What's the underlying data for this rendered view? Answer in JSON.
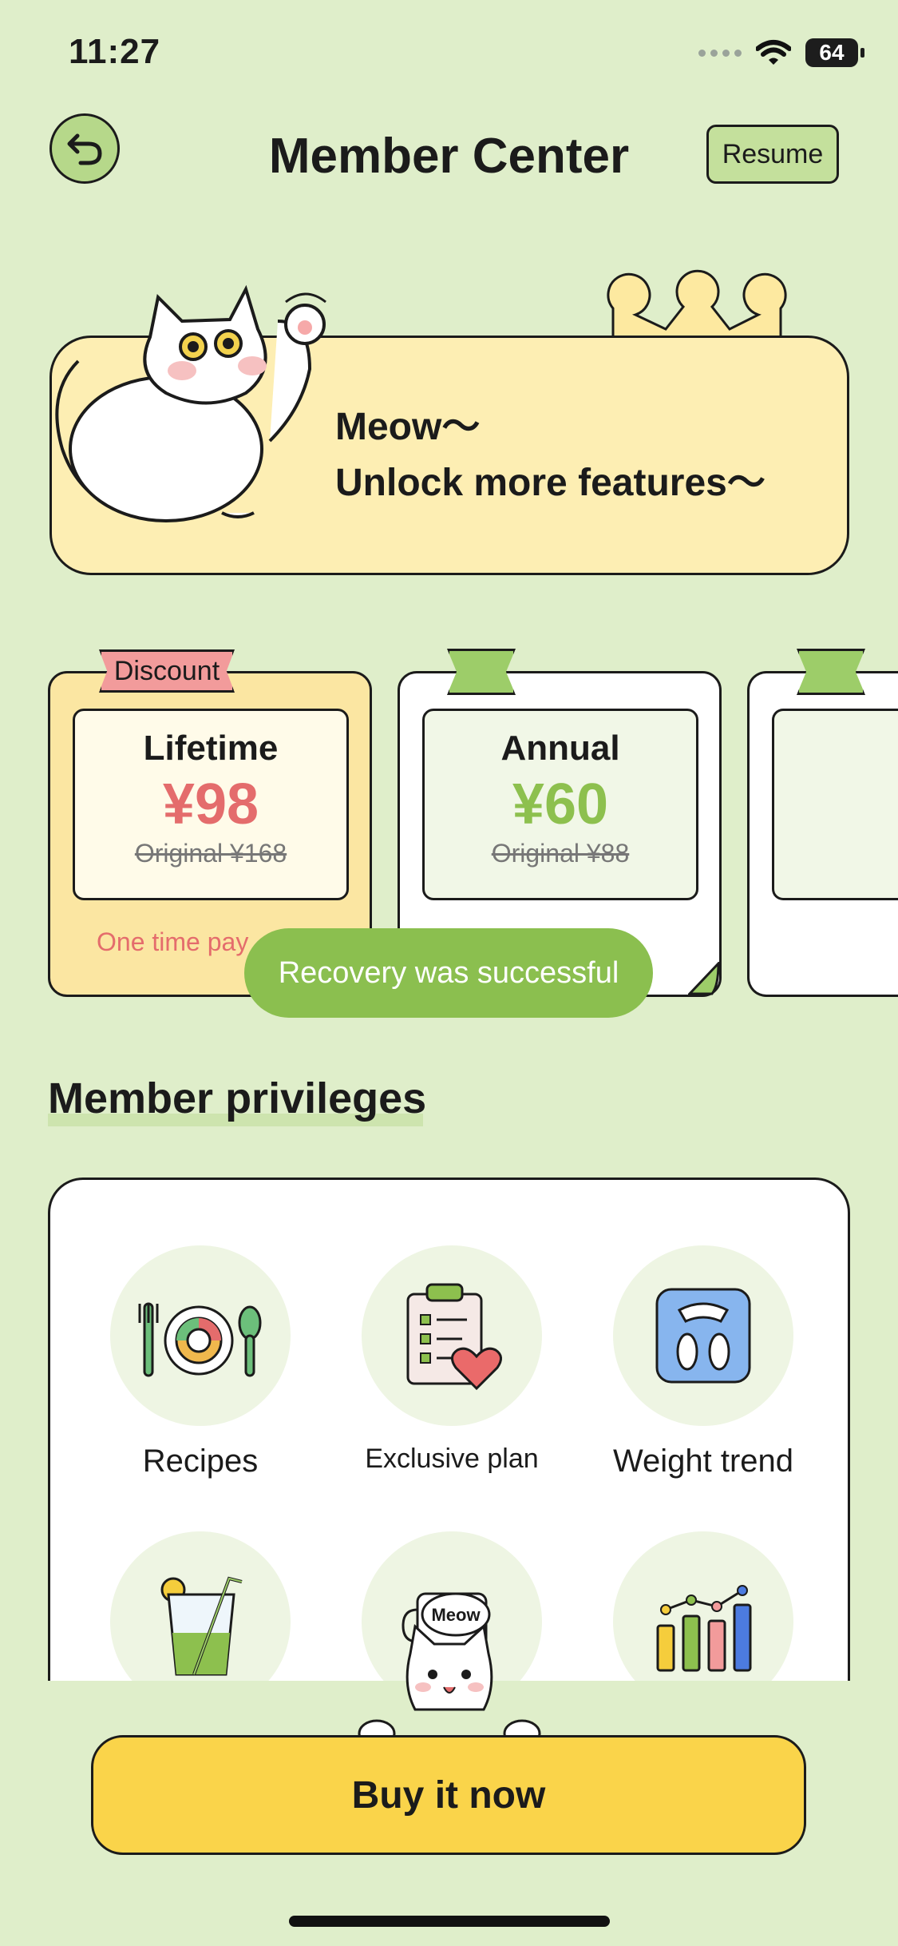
{
  "status_bar": {
    "time": "11:27",
    "battery": "64"
  },
  "header": {
    "title": "Member Center",
    "resume_label": "Resume"
  },
  "banner": {
    "line1": "Meow～",
    "line2": "Unlock more features～"
  },
  "plans": [
    {
      "name": "Lifetime",
      "price": "¥98",
      "original": "Original ¥168",
      "tag": "Discount",
      "note": "One time pay"
    },
    {
      "name": "Annual",
      "price": "¥60",
      "original": "Original ¥88"
    }
  ],
  "toast": "Recovery was successful",
  "privileges": {
    "title": "Member privileges",
    "items": [
      {
        "label": "Recipes",
        "icon": "recipes-plate-icon"
      },
      {
        "label": "Exclusive plan",
        "icon": "clipboard-heart-icon"
      },
      {
        "label": "Weight trend",
        "icon": "scale-icon"
      },
      {
        "label": "",
        "icon": "drink-glass-icon"
      },
      {
        "label": "",
        "icon": "meow-cup-icon"
      },
      {
        "label": "",
        "icon": "bar-chart-icon"
      }
    ]
  },
  "buy_label": "Buy it now",
  "colors": {
    "background": "#dfeeca",
    "accent_green": "#8bbf4f",
    "price_red": "#e46c6c",
    "button_yellow": "#fad44a"
  }
}
